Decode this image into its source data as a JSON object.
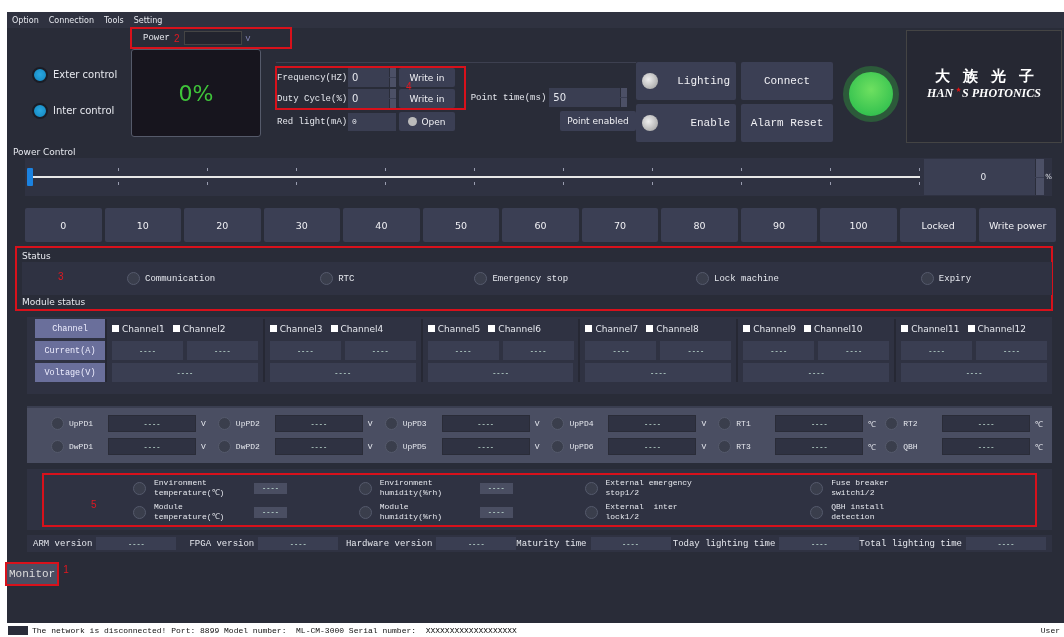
{
  "menu": [
    "Option",
    "Connection",
    "Tools",
    "Setting"
  ],
  "power": {
    "label": "Power",
    "unit": "V",
    "callout": "2"
  },
  "control_modes": [
    {
      "label": "Exter control",
      "on": true
    },
    {
      "label": "Inter control",
      "on": true
    }
  ],
  "display": {
    "text": "0%"
  },
  "settings": {
    "callout": "4",
    "rows": [
      {
        "label": "Frequency(HZ)",
        "value": "0",
        "button": "Write in"
      },
      {
        "label": "Duty Cycle(%)",
        "value": "0",
        "button": "Write in"
      }
    ]
  },
  "red_light": {
    "label": "Red light(mA)",
    "value": "0",
    "button": "Open",
    "on": false
  },
  "point_time": {
    "label": "Point time(ms)",
    "value": "50",
    "button": "Point enabled"
  },
  "indicators": [
    {
      "label": "Lighting",
      "on": false,
      "button": "Connect"
    },
    {
      "label": "Enable",
      "on": false,
      "button": "Alarm Reset"
    }
  ],
  "connection_light": {
    "on": true
  },
  "logo": {
    "chinese": [
      "大",
      "族",
      "光",
      "子"
    ],
    "english_left": "HAN",
    "english_right": "S PHOTONICS"
  },
  "power_control": {
    "title": "Power Control",
    "level": 0,
    "value": "0",
    "unit": "%"
  },
  "presets": [
    "0",
    "10",
    "20",
    "30",
    "40",
    "50",
    "60",
    "70",
    "80",
    "90",
    "100",
    "Locked",
    "Write power"
  ],
  "status": {
    "title": "Status",
    "callout": "3",
    "items": [
      {
        "label": "Communication",
        "on": false
      },
      {
        "label": "RTC",
        "on": false
      },
      {
        "label": "Emergency stop",
        "on": false
      },
      {
        "label": "Lock machine",
        "on": false
      },
      {
        "label": "Expiry",
        "on": false
      }
    ]
  },
  "module_status": {
    "title": "Module status",
    "row_headers": [
      "Channel",
      "Current(A)",
      "Voltage(V)"
    ],
    "groups": [
      {
        "channels": [
          {
            "label": "Channel1",
            "checked": false
          },
          {
            "label": "Channel2",
            "checked": false
          }
        ],
        "currents": [
          "----",
          "----"
        ],
        "voltage": "----"
      },
      {
        "channels": [
          {
            "label": "Channel3",
            "checked": false
          },
          {
            "label": "Channel4",
            "checked": false
          }
        ],
        "currents": [
          "----",
          "----"
        ],
        "voltage": "----"
      },
      {
        "channels": [
          {
            "label": "Channel5",
            "checked": false
          },
          {
            "label": "Channel6",
            "checked": false
          }
        ],
        "currents": [
          "----",
          "----"
        ],
        "voltage": "----"
      },
      {
        "channels": [
          {
            "label": "Channel7",
            "checked": false
          },
          {
            "label": "Channel8",
            "checked": false
          }
        ],
        "currents": [
          "----",
          "----"
        ],
        "voltage": "----"
      },
      {
        "channels": [
          {
            "label": "Channel9",
            "checked": false
          },
          {
            "label": "Channel10",
            "checked": false
          }
        ],
        "currents": [
          "----",
          "----"
        ],
        "voltage": "----"
      },
      {
        "channels": [
          {
            "label": "Channel11",
            "checked": false
          },
          {
            "label": "Channel12",
            "checked": false
          }
        ],
        "currents": [
          "----",
          "----"
        ],
        "voltage": "----"
      }
    ]
  },
  "sensors": [
    [
      {
        "label": "UpPD1",
        "on": false,
        "value": "----",
        "unit": "V"
      },
      {
        "label": "UpPD2",
        "on": false,
        "value": "----",
        "unit": "V"
      },
      {
        "label": "UpPD3",
        "on": false,
        "value": "----",
        "unit": "V"
      },
      {
        "label": "UpPD4",
        "on": false,
        "value": "----",
        "unit": "V"
      },
      {
        "label": "RT1",
        "on": false,
        "value": "----",
        "unit": "℃"
      },
      {
        "label": "RT2",
        "on": false,
        "value": "----",
        "unit": "℃"
      }
    ],
    [
      {
        "label": "DwPD1",
        "on": false,
        "value": "----",
        "unit": "V"
      },
      {
        "label": "DwPD2",
        "on": false,
        "value": "----",
        "unit": "V"
      },
      {
        "label": "UpPD5",
        "on": false,
        "value": "----",
        "unit": "V"
      },
      {
        "label": "UpPD6",
        "on": false,
        "value": "----",
        "unit": "V"
      },
      {
        "label": "RT3",
        "on": false,
        "value": "----",
        "unit": "℃"
      },
      {
        "label": "QBH",
        "on": false,
        "value": "----",
        "unit": "℃"
      }
    ]
  ],
  "environment": {
    "callout": "5",
    "rows": [
      [
        {
          "lines": [
            "Environment",
            "temperature(℃)"
          ],
          "on": false,
          "value": "----"
        },
        {
          "lines": [
            "Environment",
            "humidity(%rh)"
          ],
          "on": false,
          "value": "----"
        },
        {
          "lines": [
            "External emergency",
            "stop1/2"
          ],
          "on": false
        },
        {
          "lines": [
            "Fuse breaker",
            "switch1/2"
          ],
          "on": false
        }
      ],
      [
        {
          "lines": [
            "Module",
            "temperature(℃)"
          ],
          "on": false,
          "value": "----"
        },
        {
          "lines": [
            "Module",
            "humidity(%rh)"
          ],
          "on": false,
          "value": "----"
        },
        {
          "lines": [
            "External  inter",
            "lock1/2"
          ],
          "on": false
        },
        {
          "lines": [
            "QBH install",
            "detection"
          ],
          "on": false
        }
      ]
    ]
  },
  "versions": [
    {
      "label": "ARM version",
      "value": "----"
    },
    {
      "label": "FPGA version",
      "value": "----"
    },
    {
      "label": "Hardware version",
      "value": "----"
    },
    {
      "label": "Maturity time",
      "value": "----"
    },
    {
      "label": "Today lighting time",
      "value": "----"
    },
    {
      "label": "Total lighting time",
      "value": "----"
    }
  ],
  "tabs": [
    {
      "label": "Monitor",
      "selected": true,
      "callout": "1"
    }
  ],
  "status_bar": {
    "message": "The network is disconnected! Port: 8899 Model number:  ML-CM-3000 Serial number:  XXXXXXXXXXXXXXXXXXX",
    "user": "User"
  }
}
